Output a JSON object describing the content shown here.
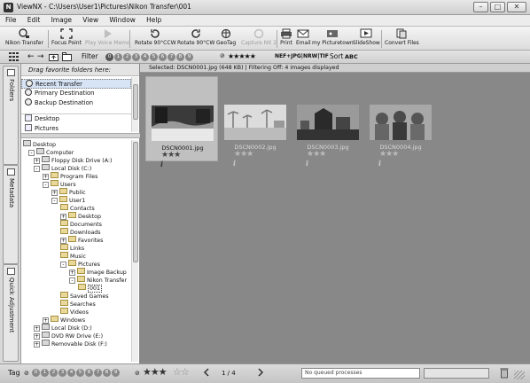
{
  "window": {
    "app_icon": "N",
    "title": "ViewNX - C:\\Users\\User1\\Pictures\\Nikon Transfer\\001",
    "buttons": [
      "–",
      "□",
      "✕"
    ]
  },
  "menu": [
    "File",
    "Edit",
    "Image",
    "View",
    "Window",
    "Help"
  ],
  "toolbar": {
    "nikon_transfer": "Nikon Transfer",
    "focus_point": "Focus Point",
    "play_voice_memo": "Play Voice Memo",
    "rotate_ccw": "Rotate 90°CCW",
    "rotate_cw": "Rotate 90°CW",
    "geotag": "GeoTag",
    "capture_nx2": "Capture NX 2",
    "print": "Print",
    "email": "Email",
    "my_picturetown": "my Picturetown",
    "slideshow": "SlideShow",
    "convert_files": "Convert Files"
  },
  "filterbar": {
    "filter_label": "Filter",
    "label_numbers": [
      "0",
      "1",
      "2",
      "3",
      "4",
      "5",
      "6",
      "7",
      "8",
      "9"
    ],
    "rating_filter": "★★★★★",
    "format_filter": "NEF+JPG|NRW|TIF",
    "sort_label": "Sort",
    "sort_value": "ABC"
  },
  "side_tabs": [
    "Folders",
    "Metadata",
    "Quick Adjustment"
  ],
  "favorites": {
    "header": "Drag favorite folders here:",
    "items": [
      "Recent Transfer",
      "Primary Destination",
      "Backup Destination"
    ],
    "extra": [
      "Desktop",
      "Pictures"
    ]
  },
  "tree": [
    {
      "label": "Desktop",
      "type": "drive",
      "exp": ""
    },
    {
      "label": "Computer",
      "type": "drive",
      "exp": "-"
    },
    {
      "label": "Floppy Disk Drive (A:)",
      "type": "drive",
      "exp": "+"
    },
    {
      "label": "Local Disk (C:)",
      "type": "drive",
      "exp": "-"
    },
    {
      "label": "Program Files",
      "type": "folder",
      "exp": "+"
    },
    {
      "label": "Users",
      "type": "folder",
      "exp": "-"
    },
    {
      "label": "Public",
      "type": "folder",
      "exp": "+"
    },
    {
      "label": "User1",
      "type": "folder",
      "exp": "-"
    },
    {
      "label": "Contacts",
      "type": "folder",
      "exp": ""
    },
    {
      "label": "Desktop",
      "type": "folder",
      "exp": "+"
    },
    {
      "label": "Documents",
      "type": "folder",
      "exp": ""
    },
    {
      "label": "Downloads",
      "type": "folder",
      "exp": ""
    },
    {
      "label": "Favorites",
      "type": "folder",
      "exp": "+"
    },
    {
      "label": "Links",
      "type": "folder",
      "exp": ""
    },
    {
      "label": "Music",
      "type": "folder",
      "exp": ""
    },
    {
      "label": "Pictures",
      "type": "folder",
      "exp": "-"
    },
    {
      "label": "Image Backup",
      "type": "folder",
      "exp": "+"
    },
    {
      "label": "Nikon Transfer",
      "type": "folder",
      "exp": "-"
    },
    {
      "label": "001",
      "type": "folder",
      "exp": ""
    },
    {
      "label": "Saved Games",
      "type": "folder",
      "exp": ""
    },
    {
      "label": "Searches",
      "type": "folder",
      "exp": ""
    },
    {
      "label": "Videos",
      "type": "folder",
      "exp": ""
    },
    {
      "label": "Windows",
      "type": "folder",
      "exp": "+"
    },
    {
      "label": "Local Disk (D:)",
      "type": "drive",
      "exp": "+"
    },
    {
      "label": "DVD RW Drive (E:)",
      "type": "drive",
      "exp": "+"
    },
    {
      "label": "Removable Disk (F:)",
      "type": "drive",
      "exp": "+"
    }
  ],
  "status": "Selected: DSCN0001.jpg (648 KB) | Filtering Off: 4 images displayed",
  "thumbnails": [
    {
      "filename": "DSCN0001.jpg",
      "stars": "★★★",
      "info": "i"
    },
    {
      "filename": "DSCN0002.jpg",
      "stars": "★★★",
      "info": "i"
    },
    {
      "filename": "DSCN0003.jpg",
      "stars": "★★★",
      "info": "i"
    },
    {
      "filename": "DSCN0004.jpg",
      "stars": "★★★",
      "info": "i"
    }
  ],
  "bottombar": {
    "tag_label": "Tag",
    "tag_numbers": [
      "0",
      "1",
      "2",
      "3",
      "4",
      "5",
      "6",
      "7",
      "8",
      "9"
    ],
    "rating_filled": "★★★",
    "rating_empty": "☆☆",
    "page_counter": "1 / 4",
    "queue_status": "No queued processes"
  },
  "colors": {
    "main_bg": "#888888",
    "selection": "#c0c0c0",
    "panel_bg": "#ffffff"
  }
}
